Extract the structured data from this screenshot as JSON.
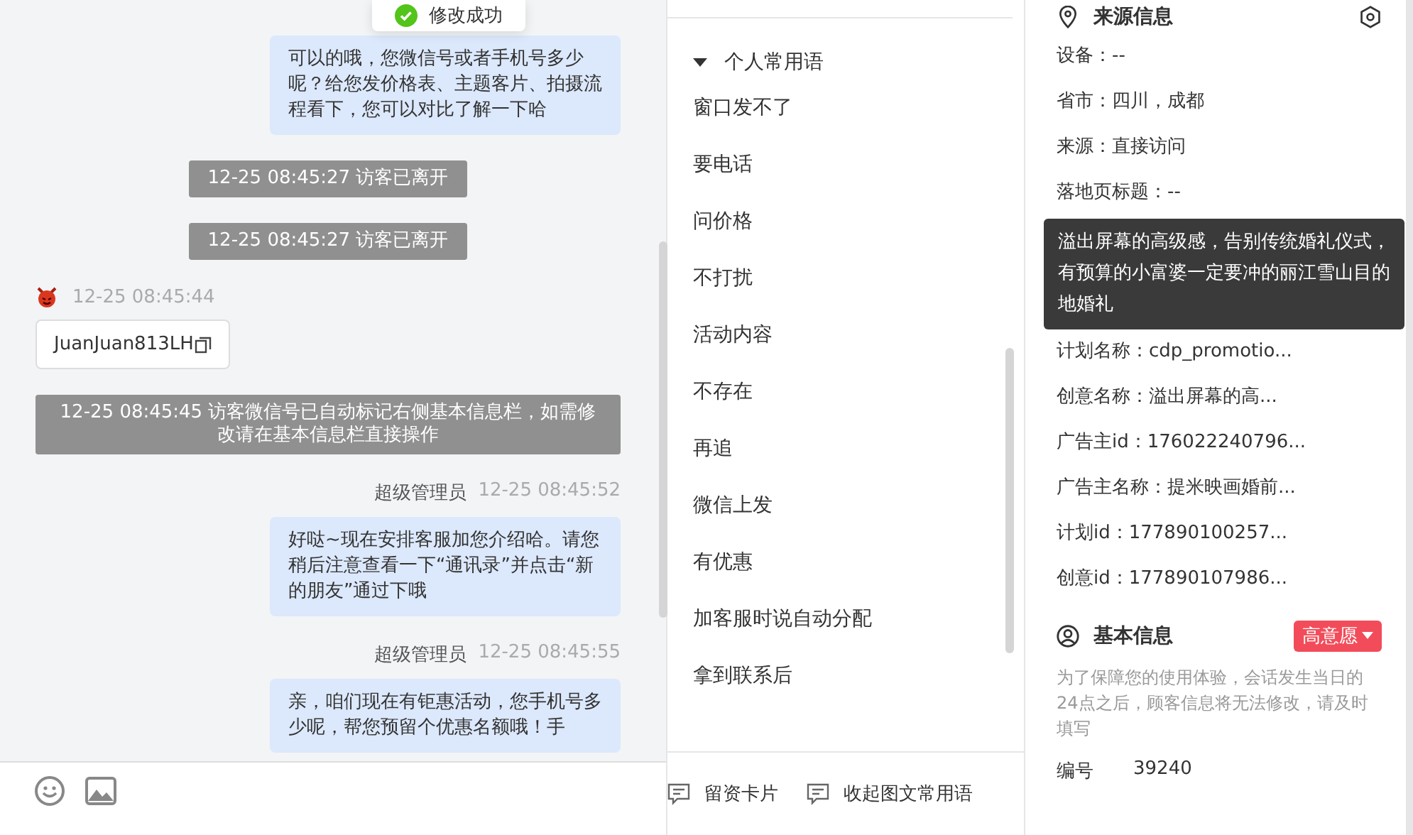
{
  "toast": {
    "text": "修改成功"
  },
  "chat": {
    "messages": [
      {
        "kind": "agent",
        "text": "可以的哦，您微信号或者手机号多少呢？给您发价格表、主题客片、拍摄流程看下，您可以对比了解一下哈"
      },
      {
        "kind": "system",
        "text": "12-25 08:45:27 访客已离开"
      },
      {
        "kind": "system",
        "text": "12-25 08:45:27 访客已离开"
      },
      {
        "kind": "visitor",
        "time": "12-25 08:45:44",
        "text": "JuanJuan813LH"
      },
      {
        "kind": "system",
        "text": "12-25 08:45:45 访客微信号已自动标记右侧基本信息栏，如需修改请在基本信息栏直接操作"
      },
      {
        "kind": "agent",
        "sender": "超级管理员",
        "time": "12-25 08:45:52",
        "text": "好哒~现在安排客服加您介绍哈。请您稍后注意查看一下“通讯录”并点击“新的朋友”通过下哦"
      },
      {
        "kind": "agent",
        "sender": "超级管理员",
        "time": "12-25 08:45:55",
        "text": "亲，咱们现在有钜惠活动，您手机号多少呢，帮您预留个优惠名额哦！手"
      }
    ]
  },
  "phrases": {
    "group": {
      "title": "个人常用语",
      "expanded": true
    },
    "items": [
      "窗口发不了",
      "要电话",
      "问价格",
      "不打扰",
      "活动内容",
      "不存在",
      "再追",
      "微信上发",
      "有优惠",
      "加客服时说自动分配",
      "拿到联系后"
    ],
    "actions": [
      "留资卡片",
      "收起图文常用语"
    ]
  },
  "source_info": {
    "title": "来源信息",
    "rows_before": [
      "设备：--",
      "省市：四川，成都",
      "来源：直接访问",
      "落地页标题：--"
    ],
    "tooltip": "溢出屏幕的高级感，告别传统婚礼仪式，有预算的小富婆一定要冲的丽江雪山目的地婚礼",
    "rows_after": [
      "计划名称：cdp_promotio...",
      "创意名称：溢出屏幕的高...",
      "广告主id：176022240796...",
      "广告主名称：提米映画婚前...",
      "计划id：177890100257...",
      "创意id：177890107986..."
    ]
  },
  "basic_info": {
    "title": "基本信息",
    "intent_tag": "高意愿",
    "notice": "为了保障您的使用体验，会话发生当日的24点之后，顾客信息将无法修改，请及时填写",
    "fields": [
      {
        "label": "编号",
        "value": "39240"
      }
    ]
  }
}
